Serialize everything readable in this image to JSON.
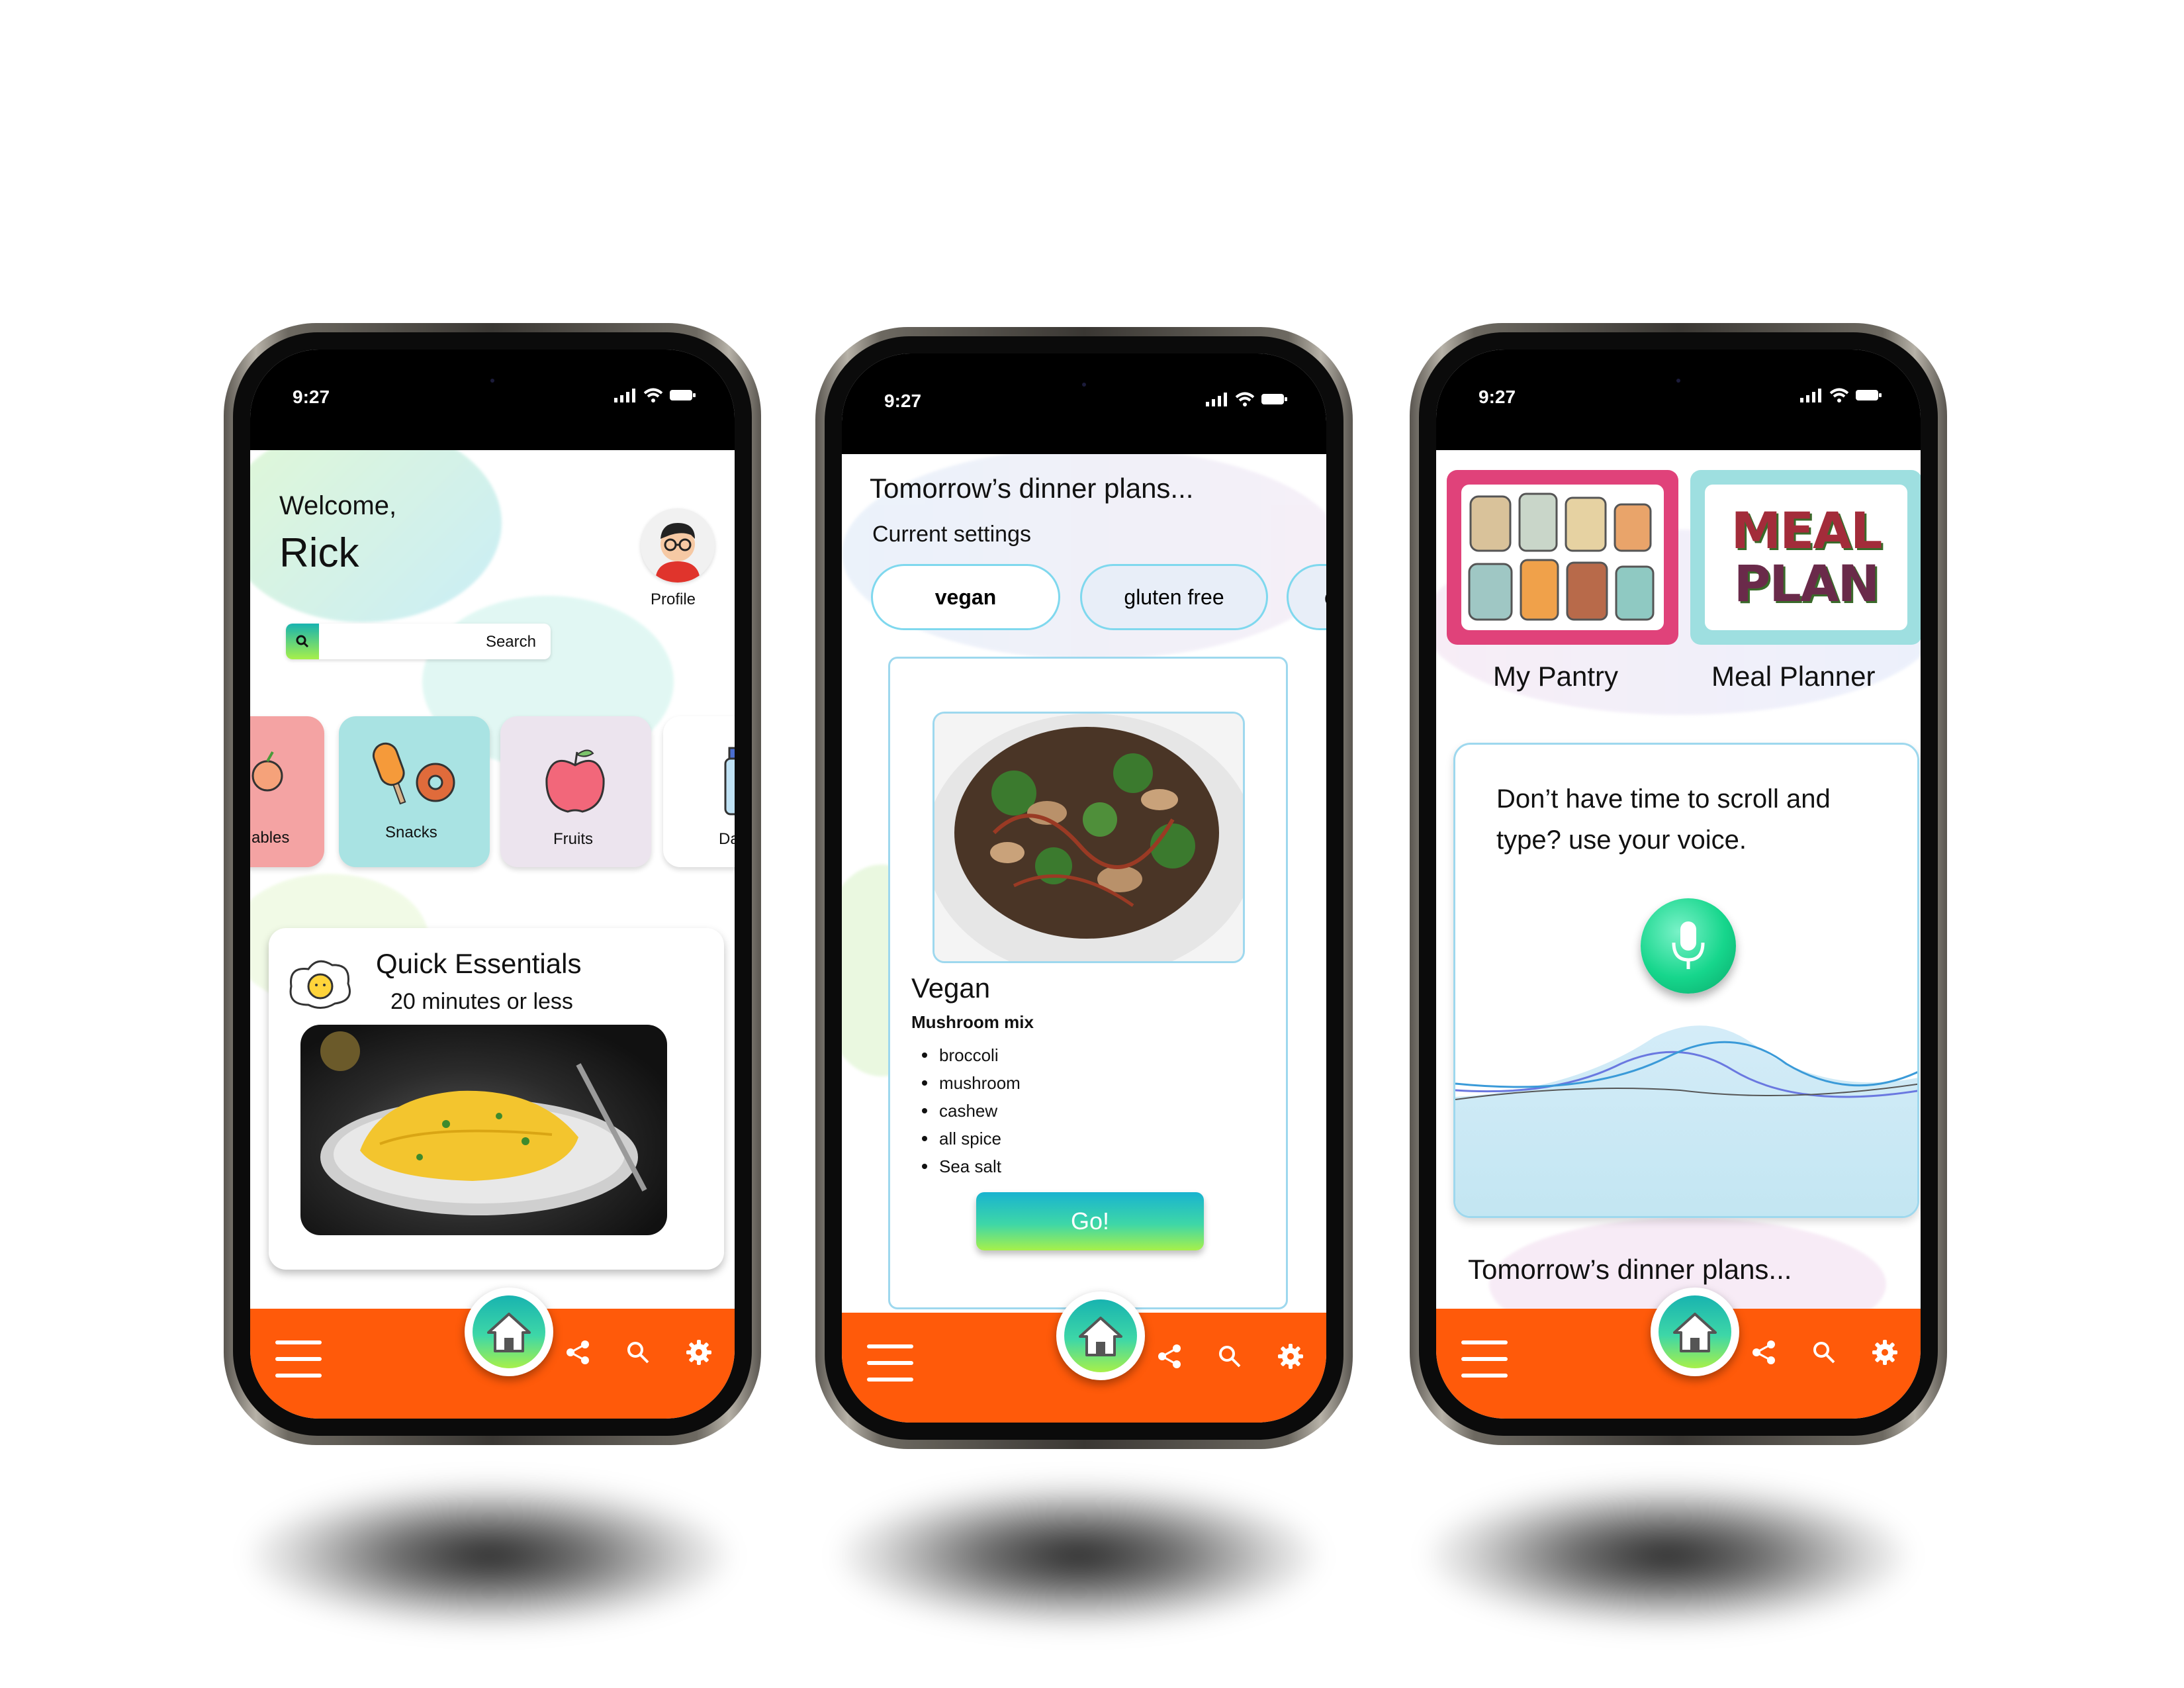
{
  "colors": {
    "navbar": "#ff5a0a",
    "accent_teal": "#18b3b0",
    "accent_green": "#a7f04a",
    "chip_border": "#7fd8ee"
  },
  "phone1": {
    "status_time": "9:27",
    "welcome": "Welcome,",
    "user_name": "Rick",
    "profile_label": "Profile",
    "search_placeholder": "Search",
    "categories": [
      {
        "label": "ables",
        "icon": "vegetable-icon"
      },
      {
        "label": "Snacks",
        "icon": "snacks-icon"
      },
      {
        "label": "Fruits",
        "icon": "apple-icon"
      },
      {
        "label": "Da",
        "icon": "milk-bottle-icon"
      }
    ],
    "quick_title": "Quick Essentials",
    "quick_subtitle": "20 minutes or less"
  },
  "phone2": {
    "status_time": "9:27",
    "heading": "Tomorrow’s dinner plans...",
    "settings_label": "Current settings",
    "chips": [
      "vegan",
      "gluten free",
      "c"
    ],
    "recipe_category": "Vegan",
    "recipe_name": "Mushroom mix",
    "ingredients": [
      "broccoli",
      "mushroom",
      "cashew",
      "all spice",
      "Sea salt"
    ],
    "go_label": "Go!"
  },
  "phone3": {
    "status_time": "9:27",
    "tile_pantry": "My Pantry",
    "tile_planner": "Meal Planner",
    "meal_plan_art": [
      "MEAL",
      "PLAN"
    ],
    "voice_prompt_line1": "Don’t have time to scroll and",
    "voice_prompt_line2": "type? use your voice.",
    "footer_heading": "Tomorrow’s dinner plans..."
  }
}
